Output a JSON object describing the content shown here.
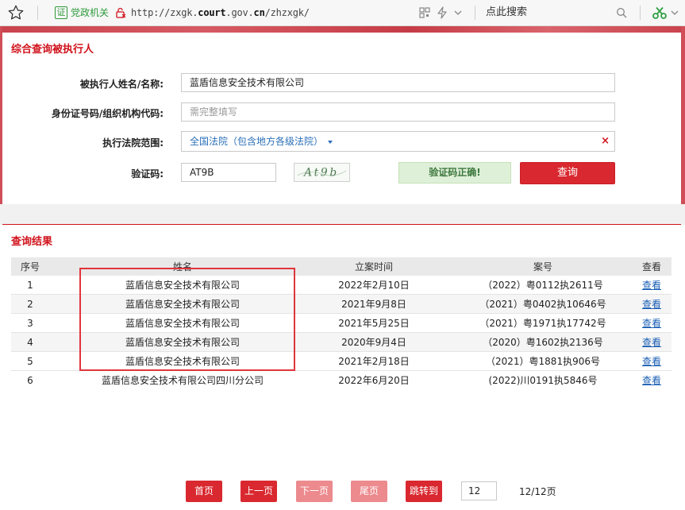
{
  "browser": {
    "cert_badge": "证",
    "cert_label": "党政机关",
    "url_prefix": "http://zxgk.",
    "url_bold": "court",
    "url_mid": ".gov.",
    "url_bold2": "cn",
    "url_suffix": "/zhzxgk/",
    "search_placeholder": "点此搜索"
  },
  "form": {
    "title": "综合查询被执行人",
    "name_label": "被执行人姓名/名称:",
    "name_value": "蓝盾信息安全技术有限公司",
    "id_label": "身份证号码/组织机构代码:",
    "id_placeholder": "需完整填写",
    "court_label": "执行法院范围:",
    "court_value": "全国法院（包含地方各级法院）",
    "clear_symbol": "×",
    "captcha_label": "验证码:",
    "captcha_value": "AT9B",
    "captcha_image_text": "At9b",
    "captcha_ok": "验证码正确!",
    "query_button": "查询"
  },
  "results": {
    "title": "查询结果",
    "headers": [
      "序号",
      "姓名",
      "立案时间",
      "案号",
      "查看"
    ],
    "rows": [
      {
        "no": "1",
        "name": "蓝盾信息安全技术有限公司",
        "date": "2022年2月10日",
        "case": "（2022）粤0112执2611号",
        "view": "查看"
      },
      {
        "no": "2",
        "name": "蓝盾信息安全技术有限公司",
        "date": "2021年9月8日",
        "case": "（2021）粤0402执10646号",
        "view": "查看"
      },
      {
        "no": "3",
        "name": "蓝盾信息安全技术有限公司",
        "date": "2021年5月25日",
        "case": "（2021）粤1971执17742号",
        "view": "查看"
      },
      {
        "no": "4",
        "name": "蓝盾信息安全技术有限公司",
        "date": "2020年9月4日",
        "case": "（2020）粤1602执2136号",
        "view": "查看"
      },
      {
        "no": "5",
        "name": "蓝盾信息安全技术有限公司",
        "date": "2021年2月18日",
        "case": "（2021）粤1881执906号",
        "view": "查看"
      },
      {
        "no": "6",
        "name": "蓝盾信息安全技术有限公司四川分公司",
        "date": "2022年6月20日",
        "case": "(2022)川0191执5846号",
        "view": "查看"
      }
    ]
  },
  "pagination": {
    "first": "首页",
    "prev": "上一页",
    "next": "下一页",
    "last": "尾页",
    "jump": "跳转到",
    "page_value": "12",
    "page_count": "12/12页"
  },
  "colors": {
    "accent_red": "#d9282f",
    "title_red": "#d0121b",
    "link_blue": "#1a5fb4",
    "ok_green": "#3c763d"
  }
}
